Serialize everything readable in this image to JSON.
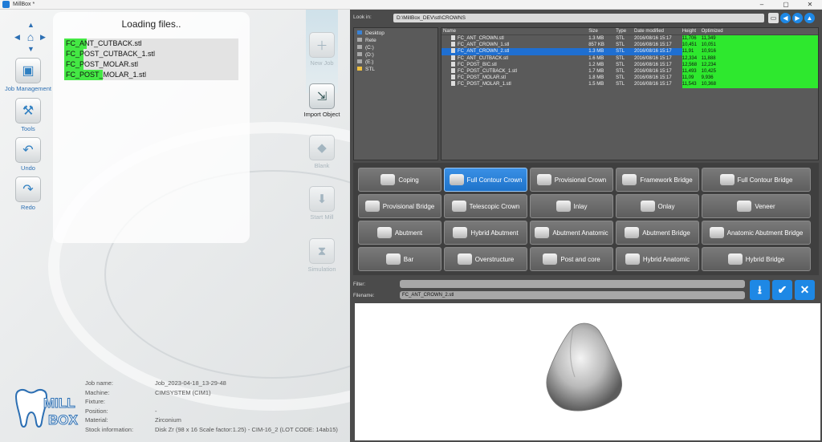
{
  "window": {
    "title": "MillBox *",
    "controls": [
      "–",
      "▢",
      "✕"
    ]
  },
  "left_toolbar": {
    "buttons": [
      {
        "label": "Job Management",
        "icon": "job-management-icon"
      },
      {
        "label": "Tools",
        "icon": "tools-icon"
      },
      {
        "label": "Undo",
        "icon": "undo-icon"
      },
      {
        "label": "Redo",
        "icon": "redo-icon"
      }
    ]
  },
  "loading": {
    "title": "Loading files..",
    "files": [
      {
        "name": "FC_ANT_CUTBACK.stl",
        "progress": 0.13
      },
      {
        "name": "FC_POST_CUTBACK_1.stl",
        "progress": 0.11
      },
      {
        "name": "FC_POST_MOLAR.stl",
        "progress": 0.11
      },
      {
        "name": "FC_POST_MOLAR_1.stl",
        "progress": 0.22
      }
    ]
  },
  "right_toolbar": {
    "buttons": [
      {
        "label": "New Job",
        "active": false
      },
      {
        "label": "Import Object",
        "active": true
      },
      {
        "label": "Blank",
        "active": false
      },
      {
        "label": "Start Mill",
        "active": false
      },
      {
        "label": "Simulation",
        "active": false
      }
    ]
  },
  "job_info": [
    {
      "key": "Job name:",
      "value": "Job_2023-04-18_13-29-48"
    },
    {
      "key": "Machine:",
      "value": "CIMSYSTEM (CIM1)"
    },
    {
      "key": "Fixture:",
      "value": ""
    },
    {
      "key": "Position:",
      "value": "-"
    },
    {
      "key": "Material:",
      "value": "Zirconium"
    },
    {
      "key": "Stock information:",
      "value": "Disk Zr (98 x 16 Scale factor:1.25) - CIM-16_2 (LOT CODE: 14ab15)"
    }
  ],
  "logo": {
    "text_top": "MILL",
    "text_bottom": "BOX"
  },
  "browser": {
    "look_in_label": "Look in:",
    "path": "D:\\MillBox_DEV\\stl\\CROWNS",
    "tree": [
      {
        "label": "Desktop",
        "kind": "desktop"
      },
      {
        "label": "Rete",
        "kind": "net"
      },
      {
        "label": "(C:)",
        "kind": "drive"
      },
      {
        "label": "(D:)",
        "kind": "drive"
      },
      {
        "label": "(E:)",
        "kind": "drive"
      },
      {
        "label": "STL",
        "kind": "folder"
      }
    ],
    "columns": [
      "Name",
      "Size",
      "Type",
      "Date modified",
      "Height",
      "Optimized"
    ],
    "rows": [
      {
        "name": "FC_ANT_CROWN.stl",
        "size": "1.3 MB",
        "type": "STL",
        "date": "2016/08/16 15:17",
        "height": "11,706",
        "optimized": "11,349",
        "selected": false
      },
      {
        "name": "FC_ANT_CROWN_1.stl",
        "size": "857 KB",
        "type": "STL",
        "date": "2016/08/16 15:17",
        "height": "10,451",
        "optimized": "10,051",
        "selected": false
      },
      {
        "name": "FC_ANT_CROWN_2.stl",
        "size": "1.3 MB",
        "type": "STL",
        "date": "2016/08/16 15:17",
        "height": "11,91",
        "optimized": "10,916",
        "selected": true
      },
      {
        "name": "FC_ANT_CUTBACK.stl",
        "size": "1.6 MB",
        "type": "STL",
        "date": "2016/08/16 15:17",
        "height": "12,334",
        "optimized": "11,888",
        "selected": false
      },
      {
        "name": "FC_POST_BIC.stl",
        "size": "1.2 MB",
        "type": "STL",
        "date": "2016/08/16 15:17",
        "height": "12,568",
        "optimized": "12,234",
        "selected": false
      },
      {
        "name": "FC_POST_CUTBACK_1.stl",
        "size": "1.7 MB",
        "type": "STL",
        "date": "2016/08/16 15:17",
        "height": "11,493",
        "optimized": "10,425",
        "selected": false
      },
      {
        "name": "FC_POST_MOLAR.stl",
        "size": "1.8 MB",
        "type": "STL",
        "date": "2016/08/16 15:17",
        "height": "11,09",
        "optimized": "9,936",
        "selected": false
      },
      {
        "name": "FC_POST_MOLAR_1.stl",
        "size": "1.5 MB",
        "type": "STL",
        "date": "2016/08/16 15:17",
        "height": "11,543",
        "optimized": "10,368",
        "selected": false
      }
    ]
  },
  "object_types": [
    {
      "label": "Coping",
      "selected": false
    },
    {
      "label": "Full Contour Crown",
      "selected": true
    },
    {
      "label": "Provisional Crown",
      "selected": false
    },
    {
      "label": "Framework Bridge",
      "selected": false
    },
    {
      "label": "Full Contour Bridge",
      "selected": false
    },
    {
      "label": "Provisional Bridge",
      "selected": false
    },
    {
      "label": "Telescopic Crown",
      "selected": false
    },
    {
      "label": "Inlay",
      "selected": false
    },
    {
      "label": "Onlay",
      "selected": false
    },
    {
      "label": "Veneer",
      "selected": false
    },
    {
      "label": "Abutment",
      "selected": false
    },
    {
      "label": "Hybrid Abutment",
      "selected": false
    },
    {
      "label": "Abutment Anatomic",
      "selected": false
    },
    {
      "label": "Abutment Bridge",
      "selected": false
    },
    {
      "label": "Anatomic Abutment Bridge",
      "selected": false
    },
    {
      "label": "Bar",
      "selected": false
    },
    {
      "label": "Overstructure",
      "selected": false
    },
    {
      "label": "Post and core",
      "selected": false
    },
    {
      "label": "Hybrid Anatomic",
      "selected": false
    },
    {
      "label": "Hybrid Bridge",
      "selected": false
    }
  ],
  "filter": {
    "label": "Filter:",
    "value": ""
  },
  "filename": {
    "label": "Filename:",
    "value": "FC_ANT_CROWN_2.stl"
  },
  "actions": {
    "download": "⭳",
    "confirm": "✔",
    "cancel": "✕"
  },
  "colors": {
    "accent": "#1e88e5",
    "progress": "#44e844",
    "panel": "#4b4b4b"
  }
}
